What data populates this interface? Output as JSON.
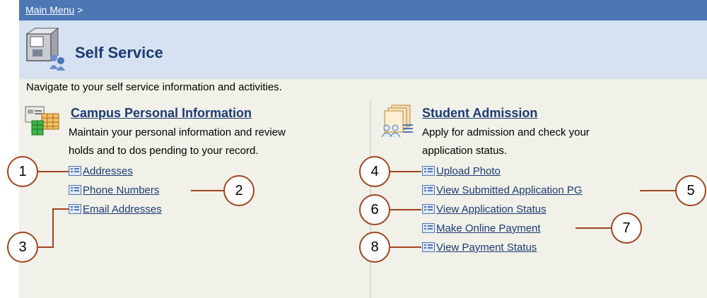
{
  "breadcrumb": {
    "main_menu": "Main Menu",
    "separator": ">"
  },
  "page": {
    "title": "Self Service",
    "intro": "Navigate to your self service information and activities."
  },
  "left": {
    "title": "Campus Personal Information",
    "desc_line1": "Maintain your personal information and review",
    "desc_line2": "holds and to dos pending to your record.",
    "links": [
      "Addresses",
      "Phone Numbers",
      "Email Addresses"
    ]
  },
  "right": {
    "title": "Student Admission",
    "desc_line1": "Apply for admission and check your",
    "desc_line2": "application status.",
    "links": [
      "Upload Photo",
      "View Submitted Application PG",
      "View Application Status",
      "Make Online Payment",
      "View Payment Status"
    ]
  },
  "callouts": [
    "1",
    "2",
    "3",
    "4",
    "5",
    "6",
    "7",
    "8"
  ],
  "colors": {
    "header_blue": "#4d76b5",
    "title_band": "#d6e2f2",
    "link": "#1c3b75",
    "callout_border": "#a0451d"
  }
}
